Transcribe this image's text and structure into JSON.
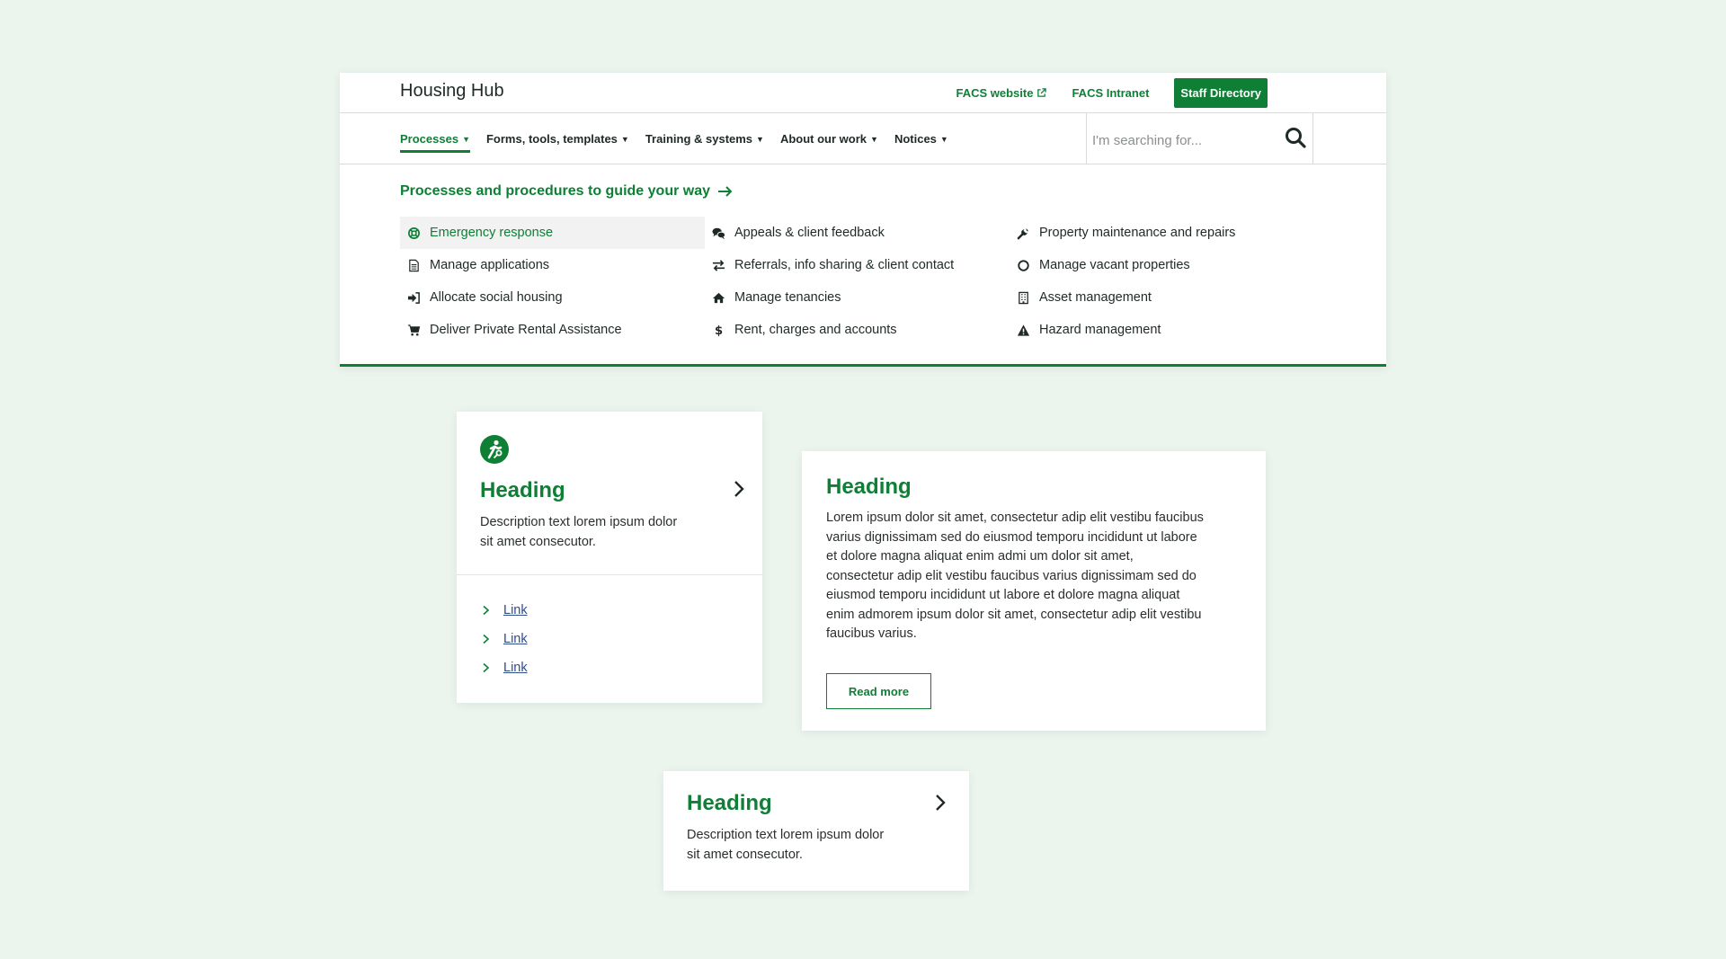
{
  "header": {
    "brand": "Housing Hub",
    "utility_links": {
      "facs_website": "FACS website",
      "facs_intranet": "FACS Intranet",
      "staff_directory": "Staff Directory"
    }
  },
  "nav": {
    "items": [
      {
        "label": "Processes",
        "active": true
      },
      {
        "label": "Forms, tools, templates"
      },
      {
        "label": "Training & systems"
      },
      {
        "label": "About our work"
      },
      {
        "label": "Notices"
      }
    ]
  },
  "search": {
    "placeholder": "I'm searching for..."
  },
  "mega_menu": {
    "title": "Processes and procedures to guide your way",
    "items": [
      {
        "label": "Emergency response",
        "icon": "lifebuoy-icon",
        "active": true
      },
      {
        "label": "Appeals & client feedback",
        "icon": "chat-bubbles-icon"
      },
      {
        "label": "Property maintenance and repairs",
        "icon": "wrench-icon"
      },
      {
        "label": "Manage applications",
        "icon": "document-icon"
      },
      {
        "label": "Referrals, info sharing & client contact",
        "icon": "exchange-icon"
      },
      {
        "label": "Manage vacant properties",
        "icon": "circle-icon"
      },
      {
        "label": "Allocate social housing",
        "icon": "sign-in-icon"
      },
      {
        "label": "Manage tenancies",
        "icon": "home-icon"
      },
      {
        "label": "Asset management",
        "icon": "building-icon"
      },
      {
        "label": "Deliver Private Rental Assistance",
        "icon": "cart-icon"
      },
      {
        "label": "Rent, charges and accounts",
        "icon": "dollar-icon"
      },
      {
        "label": "Hazard management",
        "icon": "warning-icon"
      }
    ]
  },
  "card1": {
    "icon": "user-key-badge-icon",
    "heading": "Heading",
    "description": "Description text lorem ipsum dolor sit amet consecutor.",
    "links": [
      "Link",
      "Link",
      "Link"
    ]
  },
  "card2": {
    "heading": "Heading",
    "body": "Lorem ipsum dolor sit amet, consectetur adip elit vestibu faucibus varius dignissimam sed do eiusmod temporu incididunt ut labore et dolore magna aliquat enim admi um dolor sit amet, consectetur adip elit vestibu faucibus varius dignissimam sed do eiusmod temporu incididunt ut labore et dolore magna aliquat enim admorem ipsum dolor sit amet, consectetur adip elit vestibu faucibus varius.",
    "button": "Read more"
  },
  "card3": {
    "heading": "Heading",
    "description": "Description text lorem ipsum dolor sit amet consecutor."
  },
  "colors": {
    "brand_green": "#0e7f35",
    "page_bg": "#ecf4ee",
    "link_blue": "#2e4d8a"
  }
}
